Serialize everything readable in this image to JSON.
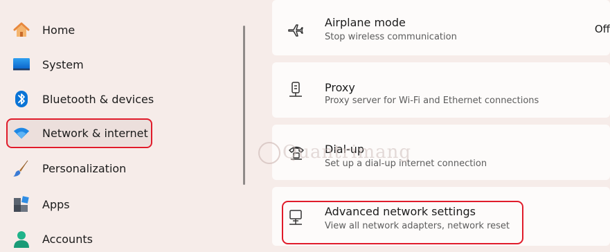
{
  "sidebar": {
    "items": [
      {
        "label": "Home",
        "icon": "home-icon"
      },
      {
        "label": "System",
        "icon": "system-icon"
      },
      {
        "label": "Bluetooth & devices",
        "icon": "bluetooth-icon"
      },
      {
        "label": "Network & internet",
        "icon": "wifi-icon",
        "active": true
      },
      {
        "label": "Personalization",
        "icon": "brush-icon"
      },
      {
        "label": "Apps",
        "icon": "apps-icon"
      },
      {
        "label": "Accounts",
        "icon": "account-icon"
      }
    ]
  },
  "settings": [
    {
      "title": "Airplane mode",
      "subtitle": "Stop wireless communication",
      "value": "Off",
      "icon": "airplane-icon"
    },
    {
      "title": "Proxy",
      "subtitle": "Proxy server for Wi-Fi and Ethernet connections",
      "icon": "proxy-icon"
    },
    {
      "title": "Dial-up",
      "subtitle": "Set up a dial-up internet connection",
      "icon": "dialup-icon"
    },
    {
      "title": "Advanced network settings",
      "subtitle": "View all network adapters, network reset",
      "icon": "advanced-network-icon"
    }
  ],
  "watermark": {
    "text": "Quantrimang"
  },
  "colors": {
    "background": "#f6ece9",
    "card": "#fdfbfa",
    "highlight": "#e01b2a",
    "accent": "#0067c0"
  }
}
